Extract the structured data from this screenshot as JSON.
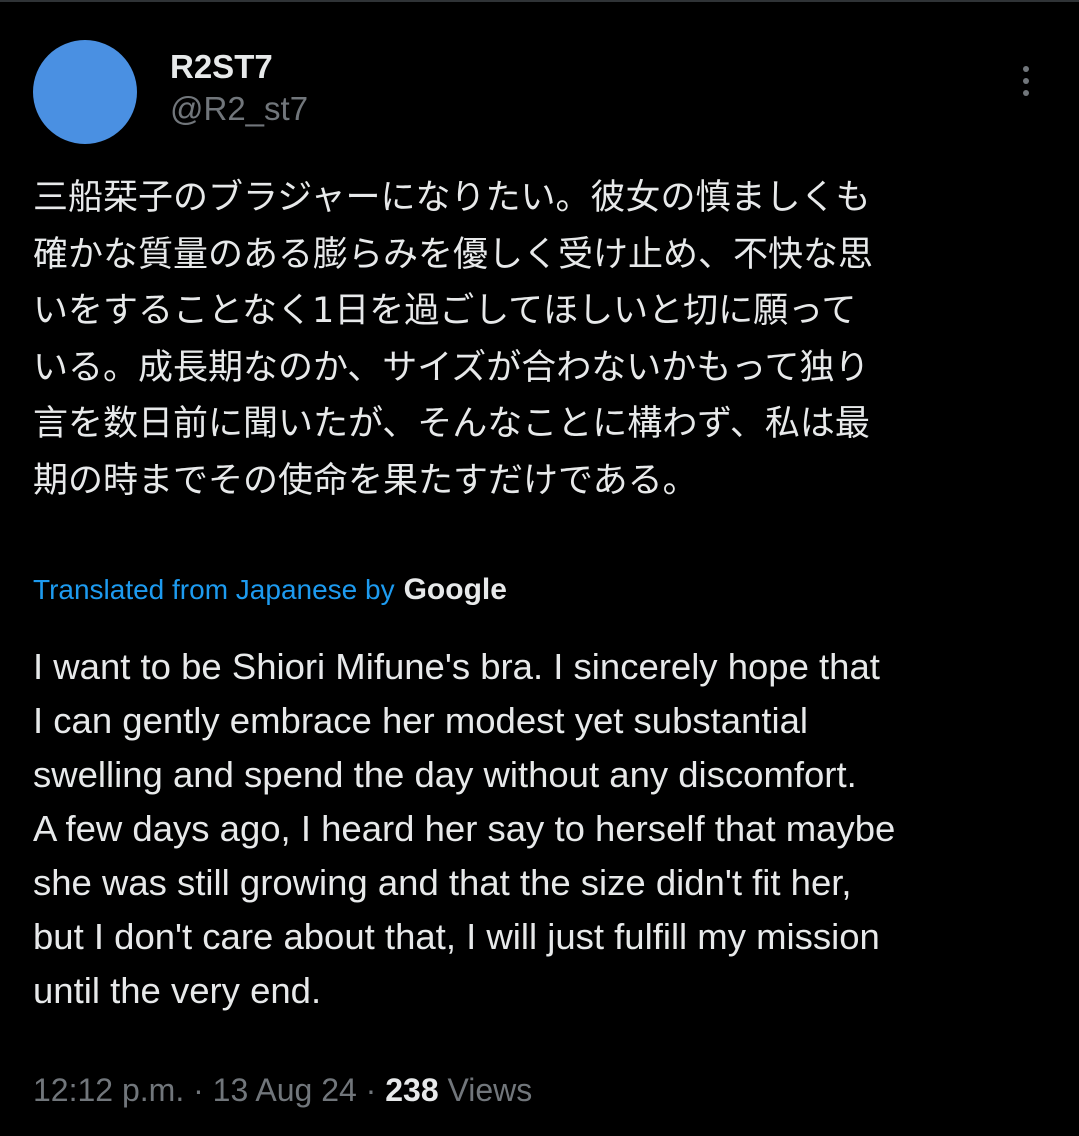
{
  "tweet": {
    "author": {
      "display_name": "R2ST7",
      "handle": "@R2_st7",
      "avatar_color": "#4a90e2"
    },
    "more_icon": "more-horizontal-icon",
    "original_text_lines": [
      "三船栞子のブラジャーになりたい。彼女の慎ましくも",
      "確かな質量のある膨らみを優しく受け止め、不快な思",
      "いをすることなく1日を過ごしてほしいと切に願って",
      "いる。成長期なのか、サイズが合わないかもって独り",
      "言を数日前に聞いたが、そんなことに構わず、私は最",
      "期の時までその使命を果たすだけである。"
    ],
    "translation": {
      "attribution": "Translated from Japanese by",
      "provider": "Google",
      "link_color": "#1d9bf0"
    },
    "translated_text_lines": [
      "I want to be Shiori Mifune's bra. I sincerely hope that",
      "I can gently embrace her modest yet substantial",
      "swelling and spend the day without any discomfort.",
      "A few days ago, I heard her say to herself that maybe",
      "she was still growing and that the size didn't fit her,",
      "but I don't care about that, I will just fulfill my mission",
      "until the very end."
    ],
    "meta": {
      "time": "12:12 p.m.",
      "separator": " · ",
      "date": "13 Aug 24",
      "views_count": "238",
      "views_label": "Views"
    }
  }
}
